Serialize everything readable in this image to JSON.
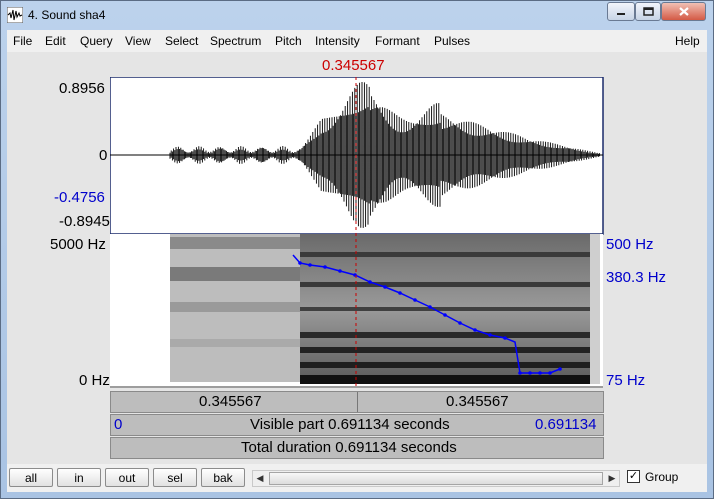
{
  "window": {
    "title": "4. Sound sha4",
    "minimize_icon": "minimize-icon",
    "maximize_icon": "maximize-icon",
    "close_icon": "close-icon"
  },
  "menu": [
    "File",
    "Edit",
    "Query",
    "View",
    "Select",
    "Spectrum",
    "Pitch",
    "Intensity",
    "Formant",
    "Pulses"
  ],
  "help": "Help",
  "cursor": {
    "time": "0.345567"
  },
  "waveform": {
    "max": "0.8956",
    "zero": "0",
    "min": "-0.8945",
    "cursor_amp": "-0.4756"
  },
  "spectrogram": {
    "top_freq": "5000 Hz",
    "bottom_freq": "0 Hz",
    "pitch_top": "500 Hz",
    "pitch_value": "380.3 Hz",
    "pitch_bottom": "75 Hz",
    "pitch_contour_color": "#0000ff"
  },
  "time_rows": {
    "left_segment": "0.345567",
    "right_segment": "0.345567",
    "start": "0",
    "visible": "Visible part 0.691134 seconds",
    "end": "0.691134",
    "total": "Total duration 0.691134 seconds"
  },
  "zoom_buttons": [
    "all",
    "in",
    "out",
    "sel",
    "bak"
  ],
  "group": {
    "label": "Group",
    "checked": true
  },
  "scroll": {
    "left_icon": "scroll-left-icon",
    "right_icon": "scroll-right-icon"
  }
}
